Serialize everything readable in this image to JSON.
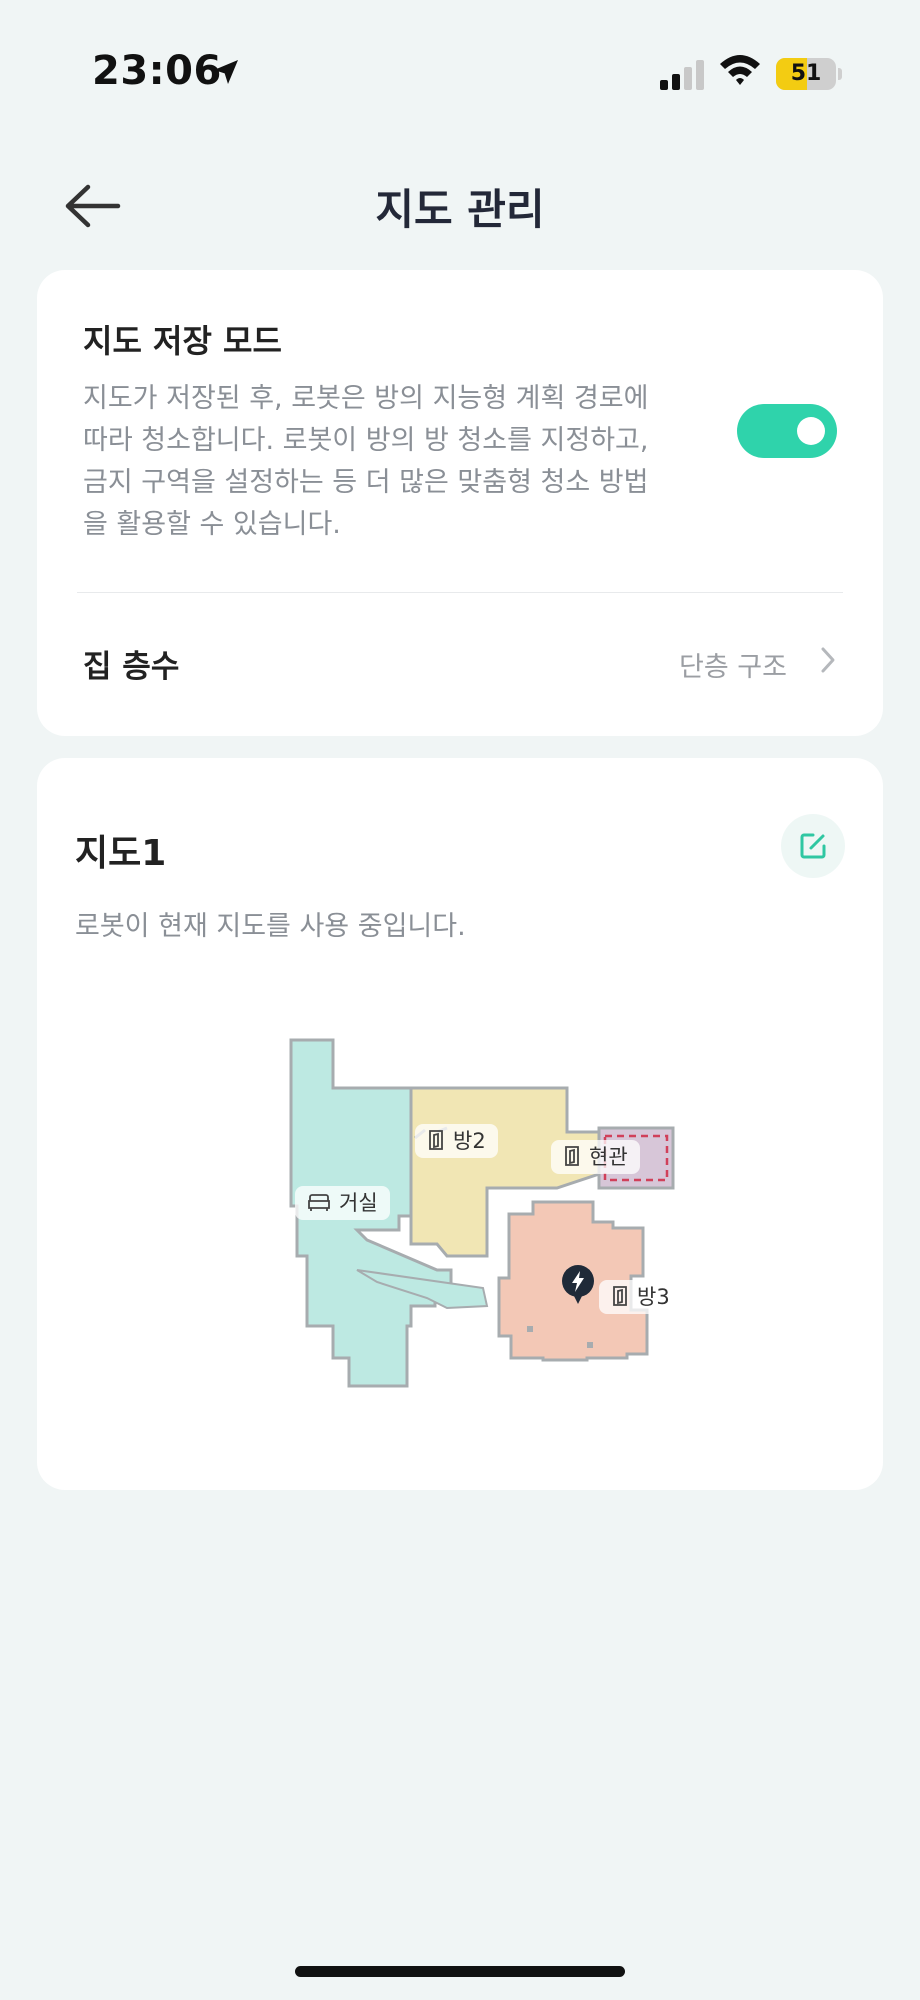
{
  "status_bar": {
    "time": "23:06",
    "battery_level": "51",
    "battery_color": "#f3cc12"
  },
  "header": {
    "title": "지도 관리",
    "back_icon": "arrow-left-icon"
  },
  "settings": {
    "save_mode_title": "지도 저장 모드",
    "save_mode_desc": "지도가 저장된 후, 로봇은 방의 지능형 계획 경로에 따라 청소합니다. 로봇이 방의 방 청소를 지정하고, 금지 구역을 설정하는 등 더 많은 맞춤형 청소 방법을 활용할 수 있습니다.",
    "save_mode_enabled": true,
    "toggle_color": "#2fd3ab",
    "floor_label": "집 층수",
    "floor_value": "단층 구조"
  },
  "map": {
    "title": "지도1",
    "status": "로봇이 현재 지도를 사용 중입니다.",
    "edit_icon": "edit-icon",
    "rooms": [
      {
        "name": "거실",
        "icon": "sofa-icon",
        "color": "#bde9e2"
      },
      {
        "name": "방2",
        "icon": "door-icon",
        "color": "#f1e6b4"
      },
      {
        "name": "현관",
        "icon": "door-icon",
        "color": "#d7c6d8"
      },
      {
        "name": "방3",
        "icon": "door-icon",
        "color": "#f3c8b6"
      }
    ],
    "robot_icon": "lightning-icon",
    "no_go_zone_color": "#d0405a"
  }
}
